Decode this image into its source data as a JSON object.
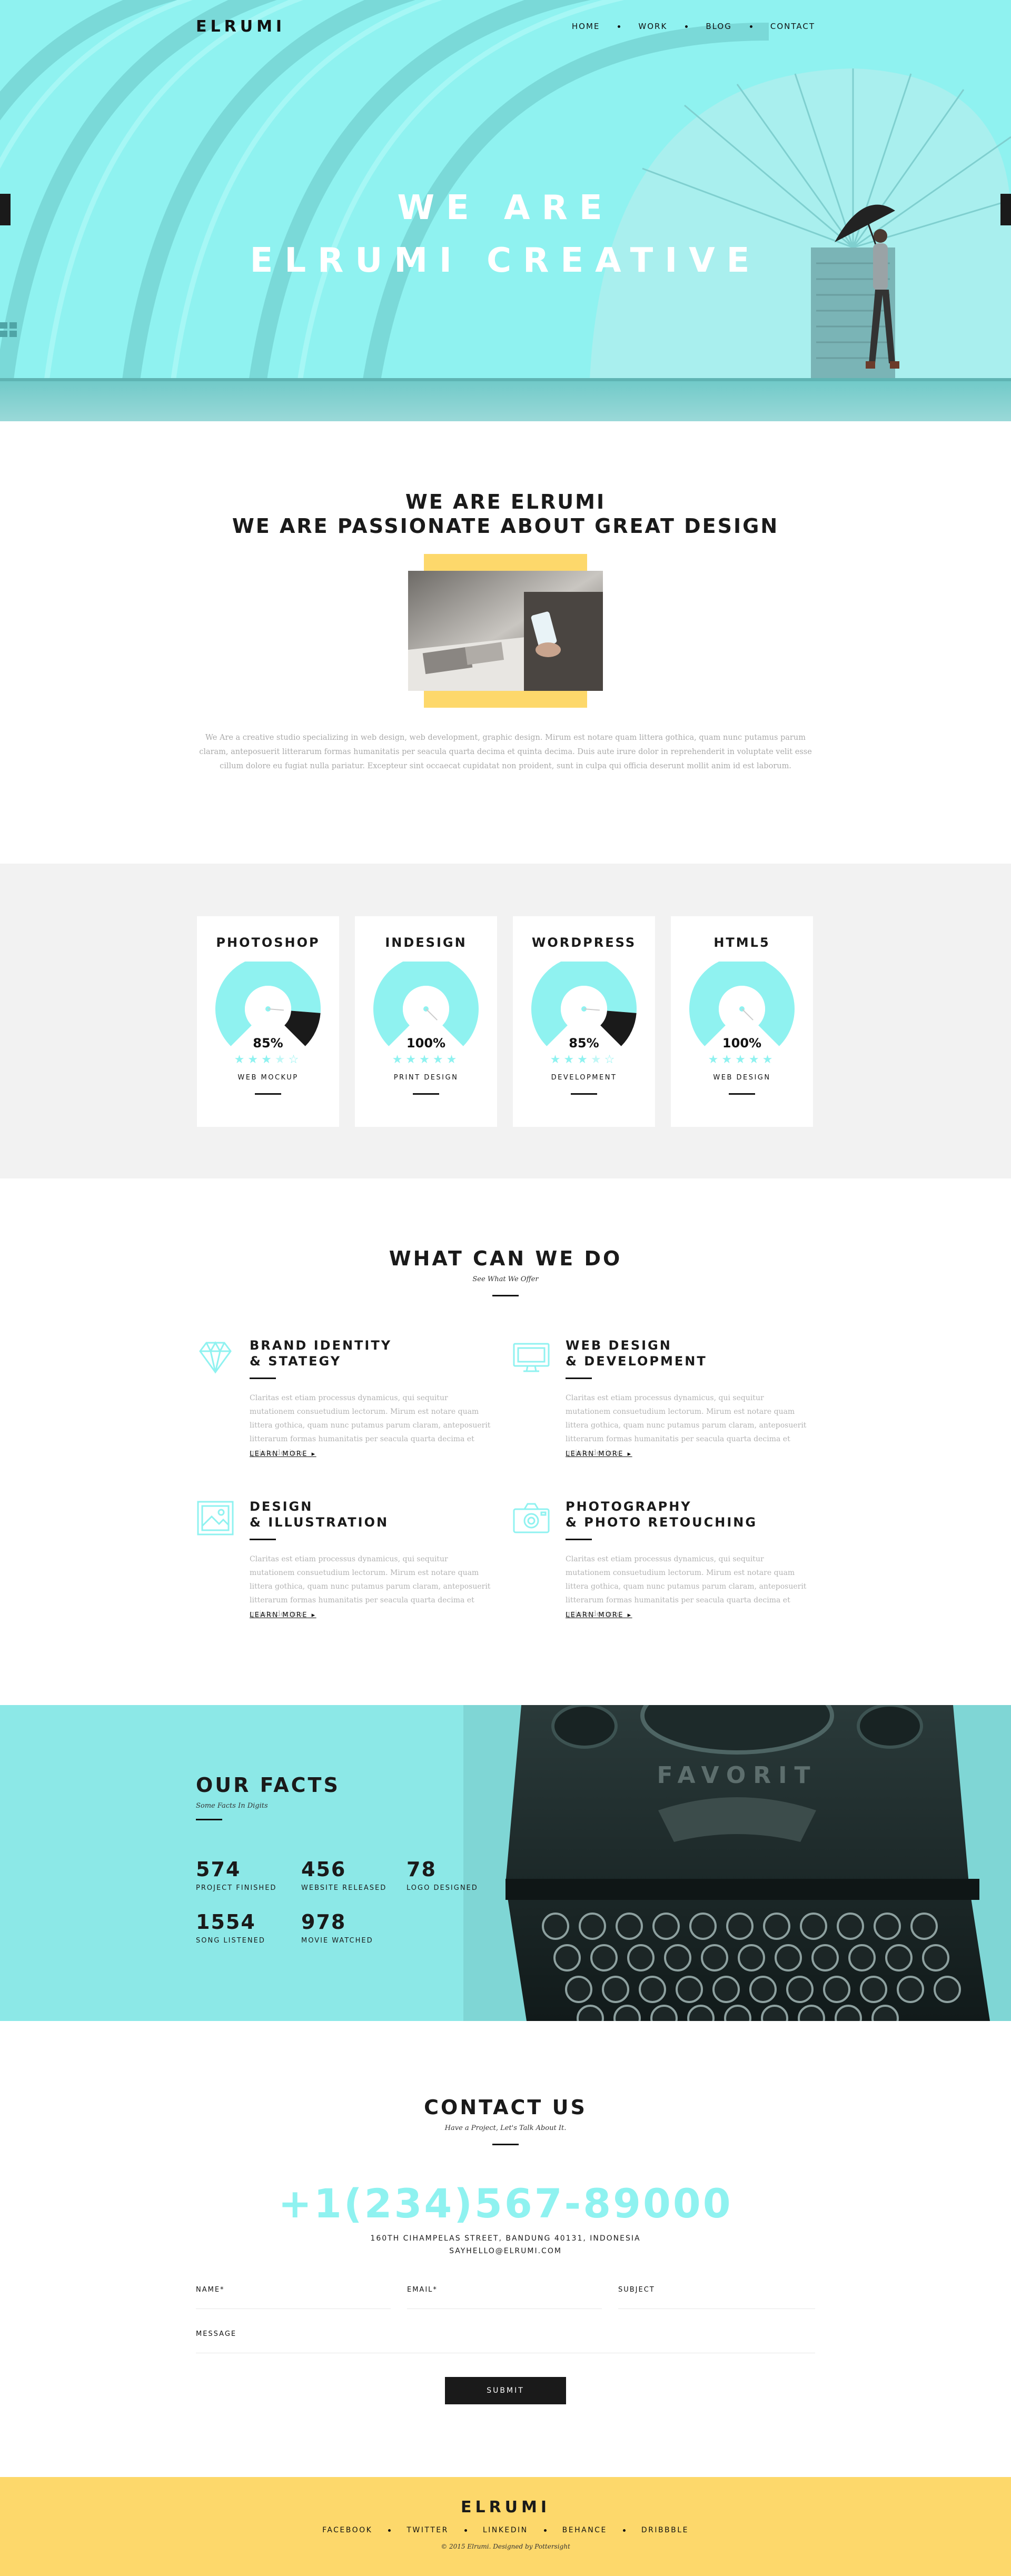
{
  "brand": "ELRUMI",
  "nav": [
    "HOME",
    "WORK",
    "BLOG",
    "CONTACT"
  ],
  "hero": {
    "line1": "WE ARE",
    "line2": "ELRUMI CREATIVE"
  },
  "about": {
    "line1": "WE ARE ELRUMI",
    "line2": "WE ARE PASSIONATE ABOUT GREAT DESIGN",
    "text": "We Are a creative studio specializing in web design, web development, graphic design. Mirum est notare quam littera gothica, quam nunc putamus parum claram, anteposuerit litterarum formas humanitatis per seacula quarta decima et quinta decima. Duis aute irure dolor in reprehenderit in voluptate velit esse cillum dolore eu fugiat nulla pariatur. Excepteur sint occaecat cupidatat non proident, sunt in culpa qui officia deserunt mollit anim id est laborum."
  },
  "skills": [
    {
      "name": "PHOTOSHOP",
      "percent": "85%",
      "value": 85,
      "rating": 3.5,
      "sub": "WEB MOCKUP"
    },
    {
      "name": "INDESIGN",
      "percent": "100%",
      "value": 100,
      "rating": 5,
      "sub": "PRINT DESIGN"
    },
    {
      "name": "WORDPRESS",
      "percent": "85%",
      "value": 85,
      "rating": 3.5,
      "sub": "DEVELOPMENT"
    },
    {
      "name": "HTML5",
      "percent": "100%",
      "value": 100,
      "rating": 5,
      "sub": "WEB DESIGN"
    }
  ],
  "services": {
    "title": "WHAT CAN WE DO",
    "subtitle": "See What We Offer",
    "items": [
      {
        "icon": "diamond-icon",
        "title1": "BRAND IDENTITY",
        "title2": "& STATEGY",
        "more": "LEARN MORE"
      },
      {
        "icon": "monitor-icon",
        "title1": "WEB DESIGN",
        "title2": "& DEVELOPMENT",
        "more": "LEARN MORE"
      },
      {
        "icon": "picture-icon",
        "title1": "DESIGN",
        "title2": "& ILLUSTRATION",
        "more": "LEARN MORE"
      },
      {
        "icon": "camera-icon",
        "title1": "PHOTOGRAPHY",
        "title2": "& PHOTO RETOUCHING",
        "more": "LEARN MORE"
      }
    ],
    "body": "Claritas est etiam processus dynamicus, qui sequitur mutationem consuetudium lectorum. Mirum est notare quam littera gothica, quam nunc putamus parum claram, anteposuerit litterarum formas humanitatis per seacula quarta decima et quinta decima."
  },
  "facts": {
    "title": "OUR FACTS",
    "subtitle": "Some Facts In Digits",
    "items": [
      {
        "num": "574",
        "label": "PROJECT FINISHED"
      },
      {
        "num": "456",
        "label": "WEBSITE RELEASED"
      },
      {
        "num": "78",
        "label": "LOGO DESIGNED"
      },
      {
        "num": "1554",
        "label": "SONG LISTENED"
      },
      {
        "num": "978",
        "label": "MOVIE WATCHED"
      }
    ],
    "typewriter_brand": "FAVORIT"
  },
  "contact": {
    "title": "CONTACT US",
    "subtitle": "Have a Project, Let's Talk About It.",
    "phone": "+1(234)567-89000",
    "address": "160TH CIHAMPELAS STREET, BANDUNG 40131, INDONESIA",
    "email": "SAYHELLO@ELRUMI.COM",
    "fields": {
      "name": "NAME*",
      "email": "EMAIL*",
      "subject": "SUBJECT",
      "message": "MESSAGE"
    },
    "submit": "SUBMIT"
  },
  "footer": {
    "social": [
      "FACEBOOK",
      "TWITTER",
      "LINKEDIN",
      "BEHANCE",
      "DRIBBBLE"
    ],
    "copyright": "© 2015 Elrumi. Designed by Pottersight"
  },
  "colors": {
    "accent": "#8ff2f0",
    "yellow": "#fdd86b",
    "dark": "#1a1a1a",
    "grey_bg": "#f2f2f2"
  }
}
